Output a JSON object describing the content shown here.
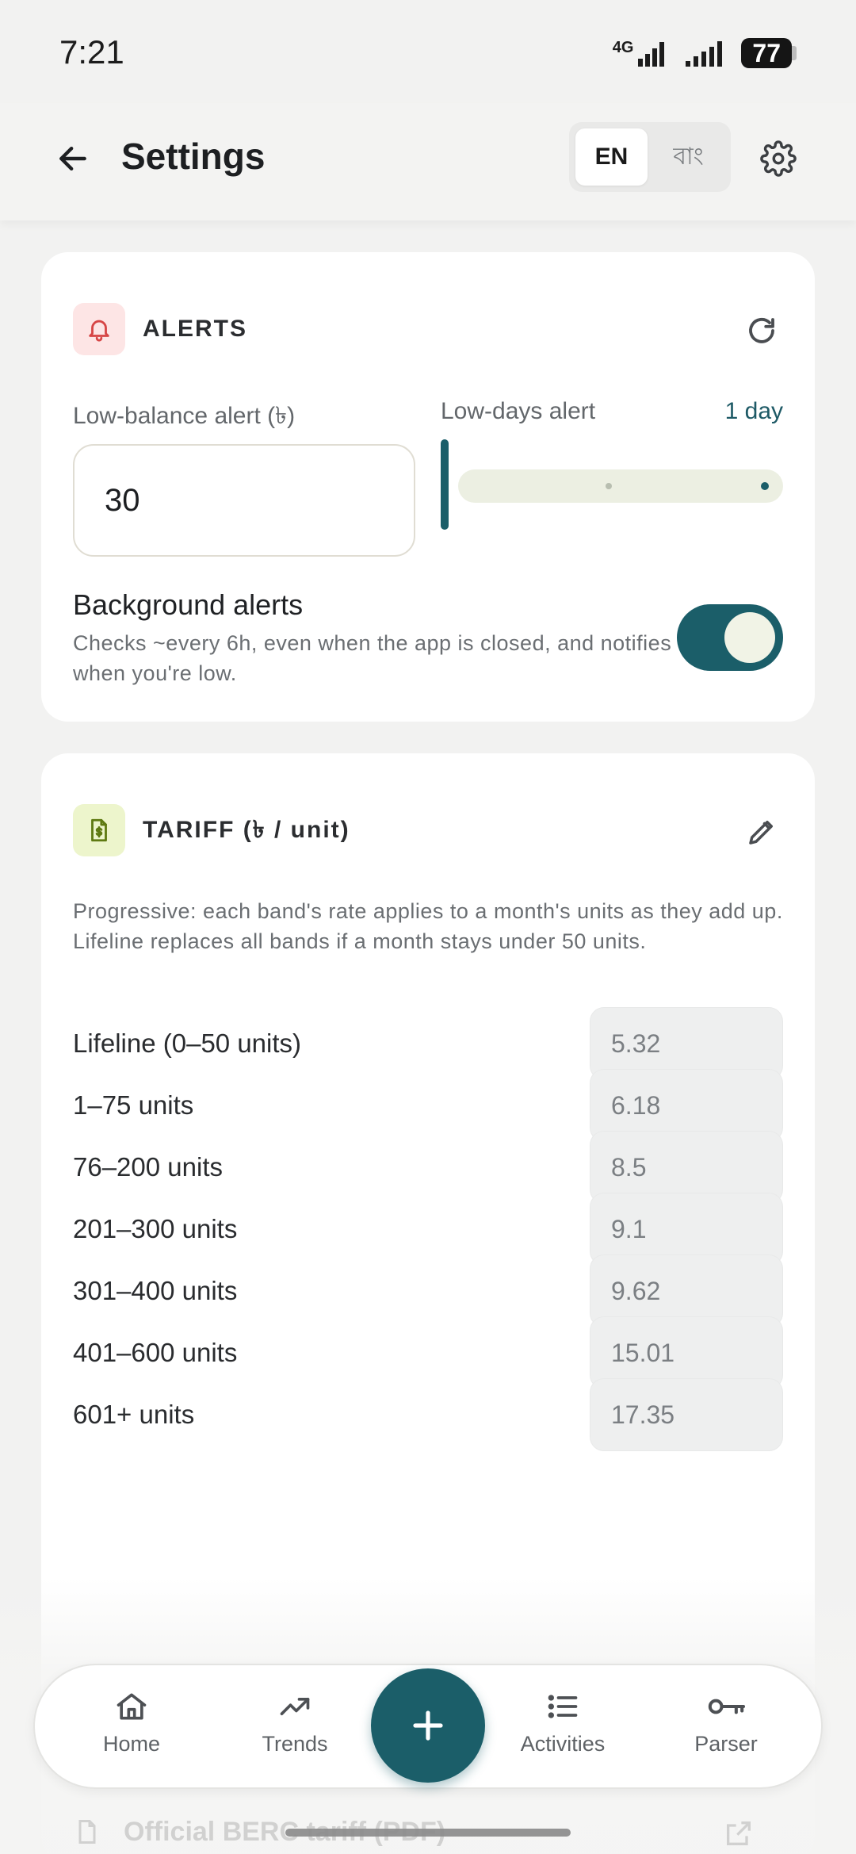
{
  "status_bar": {
    "time": "7:21",
    "network": "4G",
    "battery": "77"
  },
  "header": {
    "title": "Settings",
    "lang_options": [
      "EN",
      "বাং"
    ],
    "lang_selected": "EN"
  },
  "alerts_card": {
    "title": "ALERTS",
    "low_balance_label": "Low-balance alert (৳)",
    "low_balance_value": "30",
    "low_days_label": "Low-days alert",
    "low_days_value": "1 day",
    "background_title": "Background alerts",
    "background_desc": "Checks ~every 6h, even when the app is closed, and notifies when you're low.",
    "background_enabled": true
  },
  "tariff_card": {
    "title": "TARIFF (৳ / unit)",
    "description": "Progressive: each band's rate applies to a month's units as they add up. Lifeline replaces all bands if a month stays under 50 units.",
    "bands": [
      {
        "label": "Lifeline (0–50 units)",
        "rate": "5.32"
      },
      {
        "label": "1–75 units",
        "rate": "6.18"
      },
      {
        "label": "76–200 units",
        "rate": "8.5"
      },
      {
        "label": "201–300 units",
        "rate": "9.1"
      },
      {
        "label": "301–400 units",
        "rate": "9.62"
      },
      {
        "label": "401–600 units",
        "rate": "15.01"
      },
      {
        "label": "601+ units",
        "rate": "17.35"
      }
    ]
  },
  "behind_nav_text": "Official BERC tariff (PDF)",
  "bottom_nav": {
    "items": [
      {
        "label": "Home",
        "icon": "home-icon"
      },
      {
        "label": "Trends",
        "icon": "trending-up-icon"
      },
      {
        "label": "Activities",
        "icon": "list-icon"
      },
      {
        "label": "Parser",
        "icon": "key-icon"
      }
    ],
    "fab_icon": "plus-icon"
  },
  "colors": {
    "accent": "#1b5e69",
    "background": "#f2f2f1",
    "card": "#ffffff",
    "bell_bg": "#fde5e5",
    "doc_bg": "#edf5cc"
  }
}
